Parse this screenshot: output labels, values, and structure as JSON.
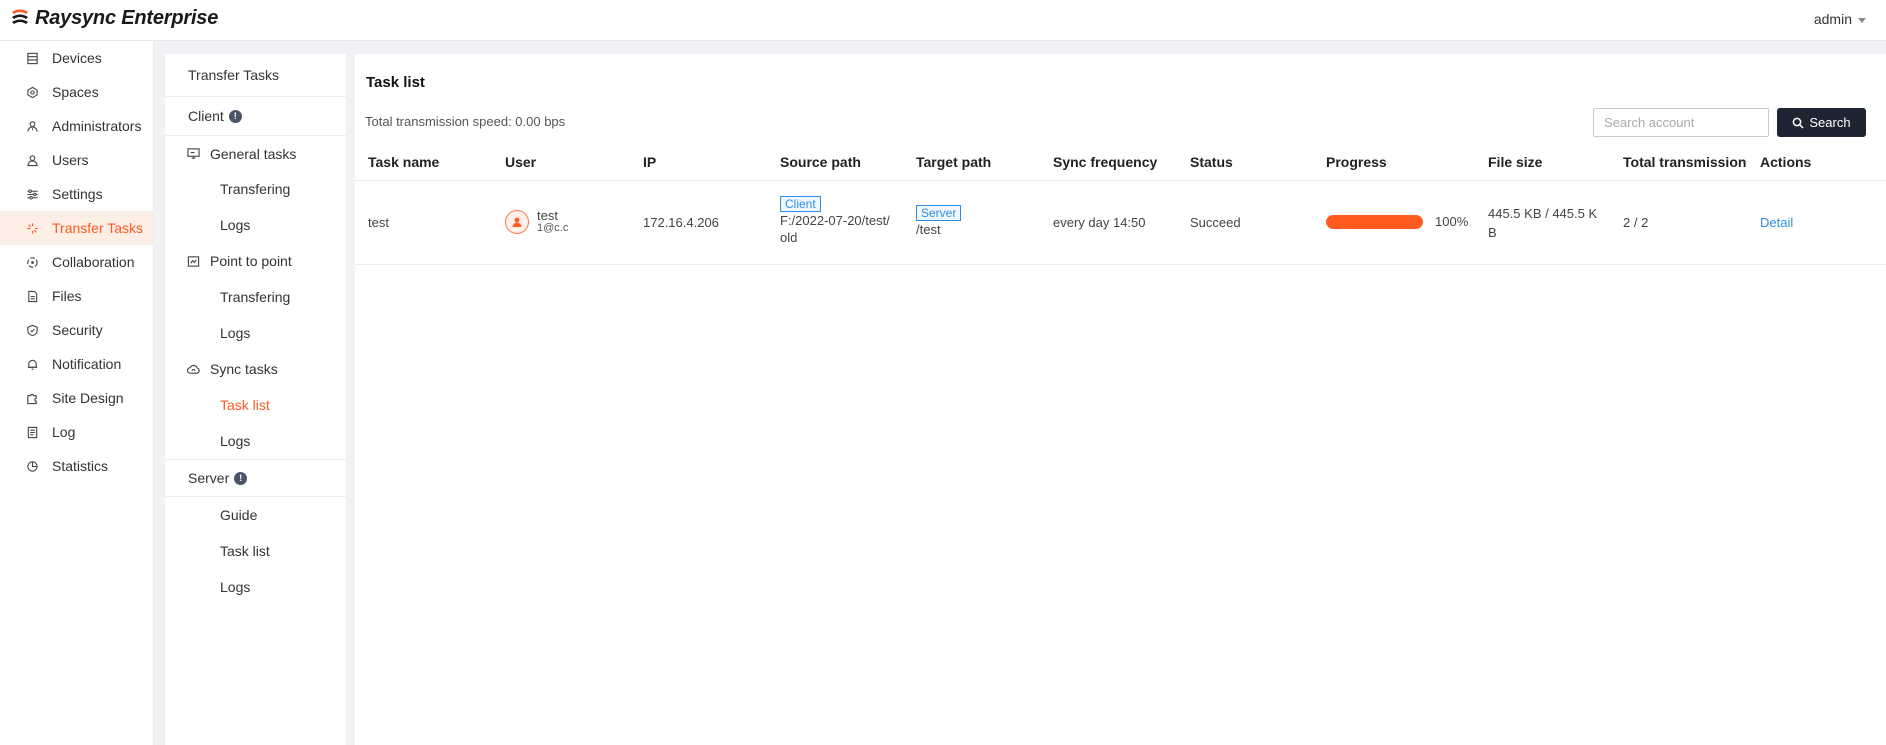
{
  "app": {
    "title": "Raysync Enterprise",
    "user": "admin"
  },
  "nav": {
    "items": [
      {
        "label": "Devices",
        "icon": "devices-icon"
      },
      {
        "label": "Spaces",
        "icon": "spaces-icon"
      },
      {
        "label": "Administrators",
        "icon": "administrators-icon"
      },
      {
        "label": "Users",
        "icon": "users-icon"
      },
      {
        "label": "Settings",
        "icon": "settings-icon"
      },
      {
        "label": "Transfer Tasks",
        "icon": "transfer-tasks-icon",
        "active": true
      },
      {
        "label": "Collaboration",
        "icon": "collaboration-icon"
      },
      {
        "label": "Files",
        "icon": "files-icon"
      },
      {
        "label": "Security",
        "icon": "security-icon"
      },
      {
        "label": "Notification",
        "icon": "bell-icon"
      },
      {
        "label": "Site Design",
        "icon": "puzzle-icon"
      },
      {
        "label": "Log",
        "icon": "log-icon"
      },
      {
        "label": "Statistics",
        "icon": "statistics-icon"
      }
    ]
  },
  "submenu": {
    "title": "Transfer Tasks",
    "client_label": "Client",
    "general_tasks": "General tasks",
    "general_transfering": "Transfering",
    "general_logs": "Logs",
    "point_to_point": "Point to point",
    "p2p_transfering": "Transfering",
    "p2p_logs": "Logs",
    "sync_tasks": "Sync tasks",
    "sync_task_list": "Task list",
    "sync_logs": "Logs",
    "server_label": "Server",
    "server_guide": "Guide",
    "server_task_list": "Task list",
    "server_logs": "Logs"
  },
  "main": {
    "title": "Task list",
    "speed": "Total transmission speed: 0.00 bps",
    "search_placeholder": "Search account",
    "search_button": "Search",
    "columns": [
      "Task name",
      "User",
      "IP",
      "Source path",
      "Target path",
      "Sync frequency",
      "Status",
      "Progress",
      "File size",
      "Total transmission",
      "Actions"
    ],
    "rows": [
      {
        "task_name": "test",
        "user_name": "test",
        "user_email": "1@c.c",
        "ip": "172.16.4.206",
        "source_tag": "Client",
        "source_path_line1": "F:/2022-07-20/test/",
        "source_path_line2": "old",
        "target_tag": "Server",
        "target_path": "/test",
        "sync_frequency": "every day 14:50",
        "status": "Succeed",
        "progress_value": 1.0,
        "progress_text": "100%",
        "file_size_line1": "445.5 KB / 445.5 K",
        "file_size_line2": "B",
        "total_transmission": "2 / 2",
        "action": "Detail"
      }
    ]
  },
  "colors": {
    "accent": "#ff5a1f",
    "link": "#2f8de4",
    "button_dark": "#1f2433",
    "active_bg": "#fdeee6"
  }
}
